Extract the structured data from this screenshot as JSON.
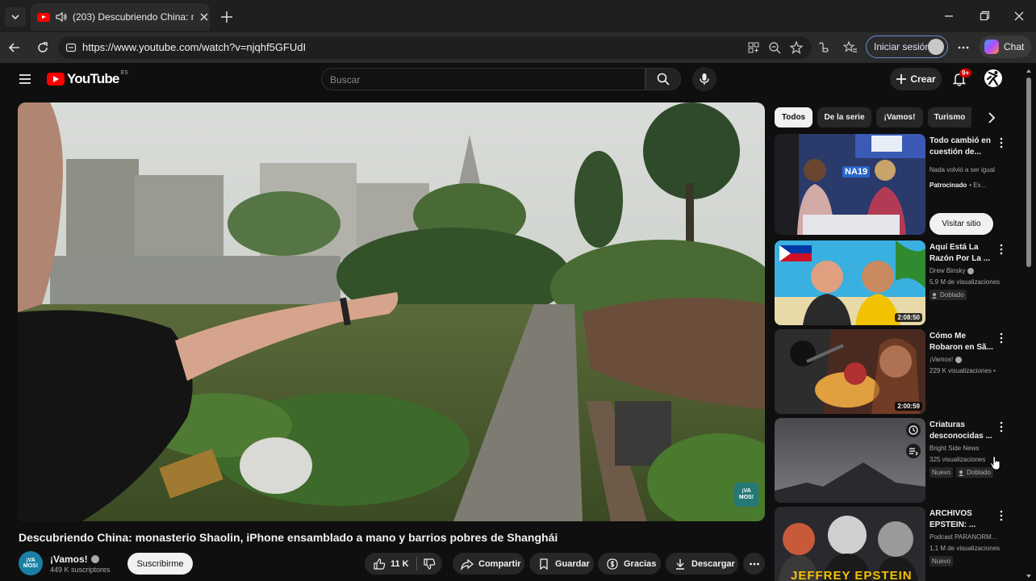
{
  "browser": {
    "tab_title": "(203) Descubriendo China: mo",
    "url": "https://www.youtube.com/watch?v=njqhf5GFUdI",
    "signin_label": "Iniciar sesión",
    "chat_label": "Chat"
  },
  "header": {
    "logo_text": "YouTube",
    "logo_country": "ES",
    "search_placeholder": "Buscar",
    "create_label": "Crear",
    "notif_badge": "9+"
  },
  "video": {
    "watermark": "¡VA MOS!",
    "title": "Descubriendo China: monasterio Shaolin, iPhone ensamblado a mano y barrios pobres de Shanghái",
    "channel": "¡Vamos!",
    "channel_avatar": "¡VA MOS!",
    "subscribers": "449 K suscriptores",
    "subscribe_label": "Suscribirme",
    "likes": "11 K",
    "share_label": "Compartir",
    "save_label": "Guardar",
    "thanks_label": "Gracias",
    "download_label": "Descargar"
  },
  "chips": [
    "Todos",
    "De la serie",
    "¡Vamos!",
    "Turismo"
  ],
  "recommendations": [
    {
      "title": "Todo cambió en cuestión de...",
      "line1": "Nada volvió a ser igual",
      "sponsored": "Patrocinado",
      "sponsored_extra": "• Ex...",
      "visit_label": "Visitar sitio",
      "thumb_text": "NA19"
    },
    {
      "title": "Aquí Está La Razón Por La ...",
      "channel": "Drew Binsky",
      "views": "5,9 M de visualizaciones",
      "badge": "Doblado",
      "duration": "2:08:50"
    },
    {
      "title": "Cómo Me Robaron en Sã...",
      "channel": "¡Vamos!",
      "views": "229 K visualizaciones •",
      "duration": "2:00:59"
    },
    {
      "title": "Criaturas desconocidas ...",
      "channel": "Bright Side News",
      "views": "325 visualizaciones",
      "badge_new": "Nuevo",
      "badge": "Doblado"
    },
    {
      "title": "ARCHIVOS EPSTEIN: ...",
      "channel": "Podcast PARANORM...",
      "views": "1,1 M de visualizaciones",
      "badge_new": "Nuevo",
      "thumb_text": "JEFFREY EPSTEIN"
    }
  ],
  "colors": {
    "background": "#0f0f0f",
    "brand_red": "#ff0000",
    "surface": "#272727",
    "text_primary": "#f1f1f1",
    "text_secondary": "#aaaaaa"
  }
}
